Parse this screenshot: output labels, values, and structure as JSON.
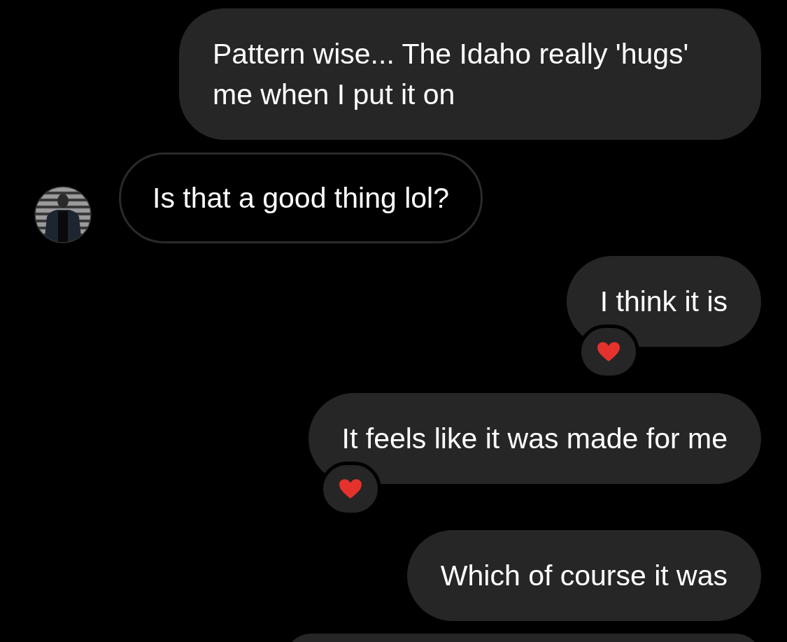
{
  "messages": [
    {
      "outgoing": true,
      "text": "Pattern wise... The Idaho really 'hugs' me when I put it on",
      "reacted": false
    },
    {
      "outgoing": false,
      "text": "Is that a good thing lol?",
      "reacted": false
    },
    {
      "outgoing": true,
      "text": "I think it is",
      "reacted": true
    },
    {
      "outgoing": true,
      "text": "It feels like it was made for me",
      "reacted": true
    },
    {
      "outgoing": true,
      "text": "Which of course it was",
      "reacted": false
    },
    {
      "outgoing": true,
      "reacted": false
    }
  ]
}
